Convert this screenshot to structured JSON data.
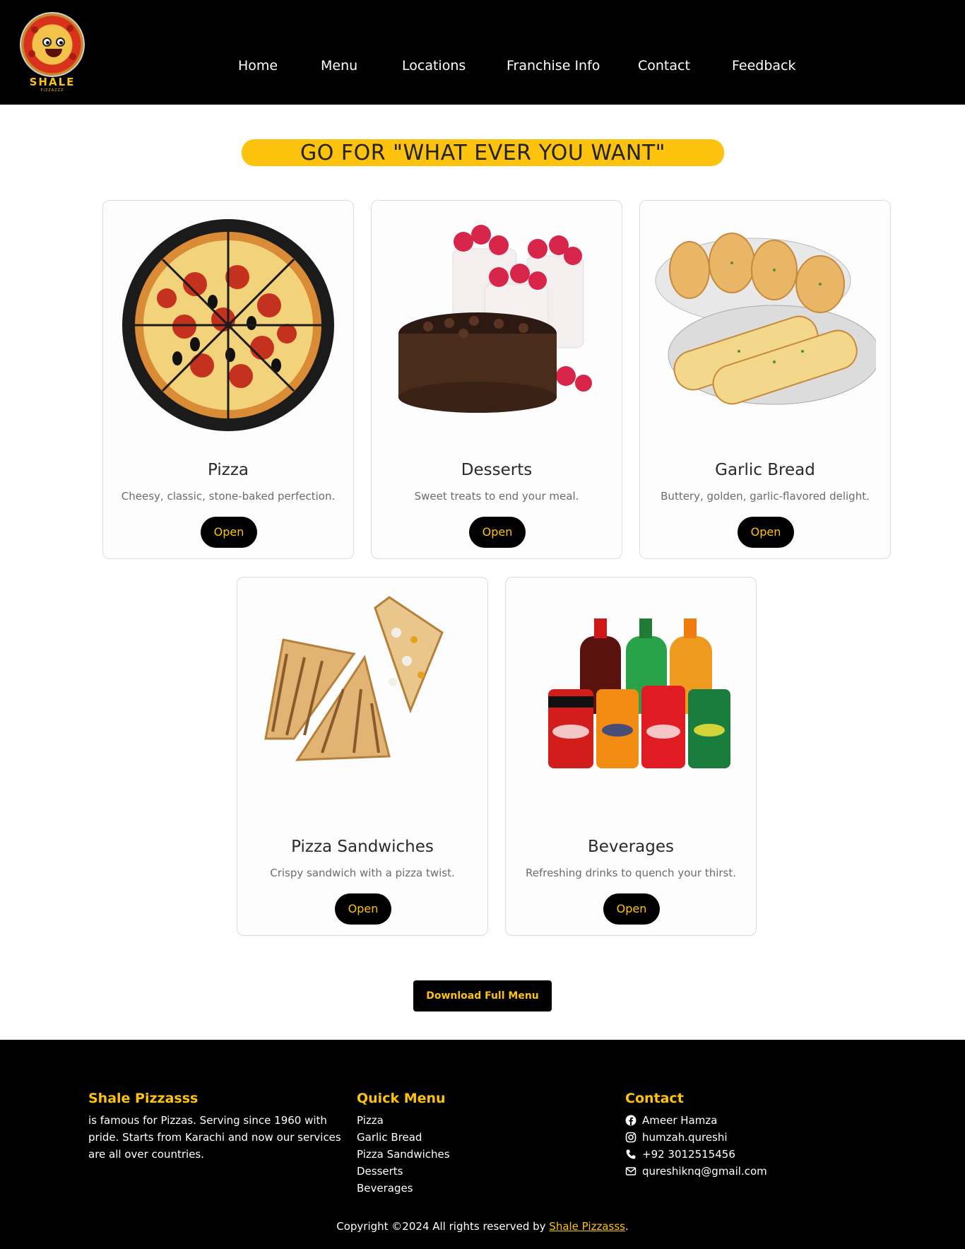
{
  "brand": {
    "logo_text": "SHALE",
    "logo_sub": "PIZZAZZZ"
  },
  "nav": [
    "Home",
    "Menu",
    "Locations",
    "Franchise Info",
    "Contact",
    "Feedback"
  ],
  "banner": "GO FOR \"WHAT EVER YOU WANT\"",
  "cards": [
    {
      "title": "Pizza",
      "desc": "Cheesy, classic, stone-baked perfection.",
      "button": "Open",
      "icon": "pizza-image"
    },
    {
      "title": "Desserts",
      "desc": "Sweet treats to end your meal.",
      "button": "Open",
      "icon": "desserts-image"
    },
    {
      "title": "Garlic Bread",
      "desc": "Buttery, golden, garlic-flavored delight.",
      "button": "Open",
      "icon": "garlic-bread-image"
    },
    {
      "title": "Pizza Sandwiches",
      "desc": "Crispy sandwich with a pizza twist.",
      "button": "Open",
      "icon": "sandwich-image"
    },
    {
      "title": "Beverages",
      "desc": "Refreshing drinks to quench your thirst.",
      "button": "Open",
      "icon": "beverages-image"
    }
  ],
  "download_label": "Download Full Menu",
  "footer": {
    "about": {
      "heading": "Shale Pizzasss",
      "text": "is famous for Pizzas. Serving since 1960 with pride. Starts from Karachi and now our services are all over countries."
    },
    "quick_menu": {
      "heading": "Quick Menu",
      "items": [
        "Pizza",
        "Garlic Bread",
        "Pizza Sandwiches",
        "Desserts",
        "Beverages"
      ]
    },
    "contact": {
      "heading": "Contact",
      "items": [
        {
          "icon": "facebook-icon",
          "text": "Ameer Hamza"
        },
        {
          "icon": "instagram-icon",
          "text": "humzah.qureshi"
        },
        {
          "icon": "phone-icon",
          "text": "+92 3012515456"
        },
        {
          "icon": "email-icon",
          "text": "qureshiknq@gmail.com"
        }
      ]
    },
    "copyright_prefix": "Copyright ©2024 All rights reserved by",
    "copyright_link": "Shale Pizzasss",
    "copyright_suffix": "."
  },
  "colors": {
    "accent": "#fdc20e",
    "header_bg": "#000000",
    "card_border": "#dcdcdc"
  }
}
